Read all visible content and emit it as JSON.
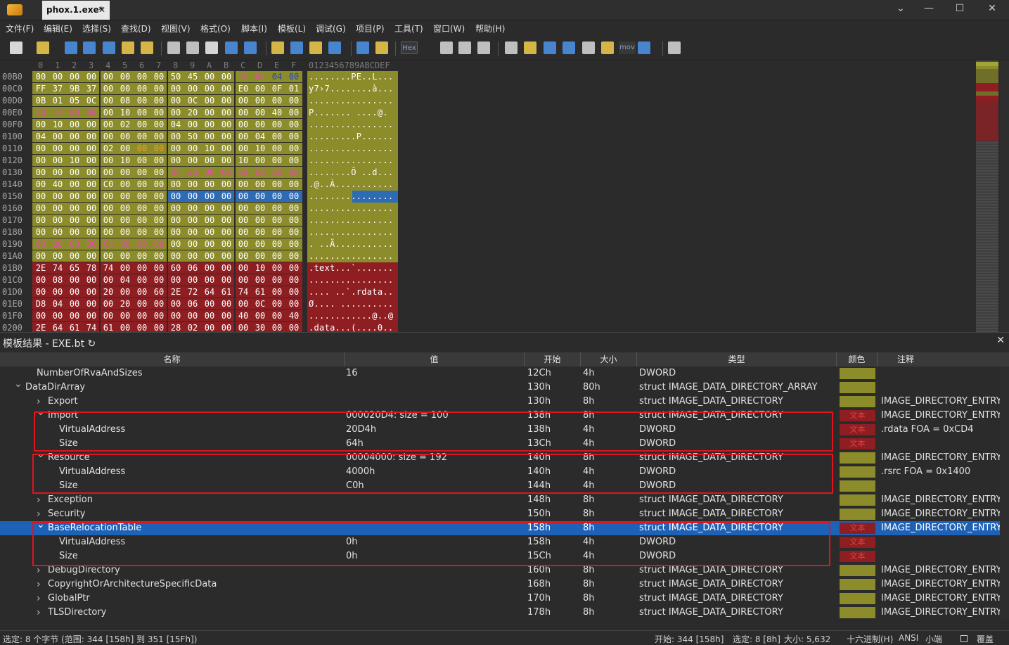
{
  "titlebar": {
    "tab_label": "phox.1.exe*",
    "controls": [
      "⌄",
      "—",
      "☐",
      "✕"
    ]
  },
  "menu": [
    "文件(F)",
    "编辑(E)",
    "选择(S)",
    "查找(D)",
    "视图(V)",
    "格式(O)",
    "脚本(I)",
    "模板(L)",
    "调试(G)",
    "项目(P)",
    "工具(T)",
    "窗口(W)",
    "帮助(H)"
  ],
  "toolbar": {
    "hex_label": "Hex",
    "mov_label": "mov"
  },
  "hex": {
    "header_cols": [
      "0",
      "1",
      "2",
      "3",
      "4",
      "5",
      "6",
      "7",
      "8",
      "9",
      "A",
      "B",
      "C",
      "D",
      "E",
      "F"
    ],
    "ascii_header": "0123456789ABCDEF",
    "rows": [
      {
        "addr": "00B0",
        "bytes": [
          "00",
          "00",
          "00",
          "00",
          "00",
          "00",
          "00",
          "00",
          "50",
          "45",
          "00",
          "00",
          "4C",
          "01",
          "04",
          "00"
        ],
        "ascii": "........PE..L..."
      },
      {
        "addr": "00C0",
        "bytes": [
          "FF",
          "37",
          "9B",
          "37",
          "00",
          "00",
          "00",
          "00",
          "00",
          "00",
          "00",
          "00",
          "E0",
          "00",
          "0F",
          "01"
        ],
        "ascii": "y7›7........à..."
      },
      {
        "addr": "00D0",
        "bytes": [
          "0B",
          "01",
          "05",
          "0C",
          "00",
          "08",
          "00",
          "00",
          "00",
          "0C",
          "00",
          "00",
          "00",
          "00",
          "00",
          "00"
        ],
        "ascii": "................"
      },
      {
        "addr": "00E0",
        "bytes": [
          "50",
          "14",
          "00",
          "00",
          "00",
          "10",
          "00",
          "00",
          "00",
          "20",
          "00",
          "00",
          "00",
          "00",
          "40",
          "00"
        ],
        "ascii": "P....... ....@."
      },
      {
        "addr": "00F0",
        "bytes": [
          "00",
          "10",
          "00",
          "00",
          "00",
          "02",
          "00",
          "00",
          "04",
          "00",
          "00",
          "00",
          "00",
          "00",
          "00",
          "00"
        ],
        "ascii": "................"
      },
      {
        "addr": "0100",
        "bytes": [
          "04",
          "00",
          "00",
          "00",
          "00",
          "00",
          "00",
          "00",
          "00",
          "50",
          "00",
          "00",
          "00",
          "04",
          "00",
          "00"
        ],
        "ascii": ".........P......"
      },
      {
        "addr": "0110",
        "bytes": [
          "00",
          "00",
          "00",
          "00",
          "02",
          "00",
          "00",
          "00",
          "00",
          "00",
          "10",
          "00",
          "00",
          "10",
          "00",
          "00"
        ],
        "ascii": "................"
      },
      {
        "addr": "0120",
        "bytes": [
          "00",
          "00",
          "10",
          "00",
          "00",
          "10",
          "00",
          "00",
          "00",
          "00",
          "00",
          "00",
          "10",
          "00",
          "00",
          "00"
        ],
        "ascii": "................"
      },
      {
        "addr": "0130",
        "bytes": [
          "00",
          "00",
          "00",
          "00",
          "00",
          "00",
          "00",
          "00",
          "D4",
          "20",
          "00",
          "00",
          "64",
          "00",
          "00",
          "00"
        ],
        "ascii": "........Ô ..d..."
      },
      {
        "addr": "0140",
        "bytes": [
          "00",
          "40",
          "00",
          "00",
          "C0",
          "00",
          "00",
          "00",
          "00",
          "00",
          "00",
          "00",
          "00",
          "00",
          "00",
          "00"
        ],
        "ascii": ".@..À..........."
      },
      {
        "addr": "0150",
        "bytes": [
          "00",
          "00",
          "00",
          "00",
          "00",
          "00",
          "00",
          "00",
          "00",
          "00",
          "00",
          "00",
          "00",
          "00",
          "00",
          "00"
        ],
        "ascii": "................"
      },
      {
        "addr": "0160",
        "bytes": [
          "00",
          "00",
          "00",
          "00",
          "00",
          "00",
          "00",
          "00",
          "00",
          "00",
          "00",
          "00",
          "00",
          "00",
          "00",
          "00"
        ],
        "ascii": "................"
      },
      {
        "addr": "0170",
        "bytes": [
          "00",
          "00",
          "00",
          "00",
          "00",
          "00",
          "00",
          "00",
          "00",
          "00",
          "00",
          "00",
          "00",
          "00",
          "00",
          "00"
        ],
        "ascii": "................"
      },
      {
        "addr": "0180",
        "bytes": [
          "00",
          "00",
          "00",
          "00",
          "00",
          "00",
          "00",
          "00",
          "00",
          "00",
          "00",
          "00",
          "00",
          "00",
          "00",
          "00"
        ],
        "ascii": "................"
      },
      {
        "addr": "0190",
        "bytes": [
          "00",
          "20",
          "00",
          "00",
          "C4",
          "00",
          "00",
          "00",
          "00",
          "00",
          "00",
          "00",
          "00",
          "00",
          "00",
          "00"
        ],
        "ascii": ". ..Ä..........."
      },
      {
        "addr": "01A0",
        "bytes": [
          "00",
          "00",
          "00",
          "00",
          "00",
          "00",
          "00",
          "00",
          "00",
          "00",
          "00",
          "00",
          "00",
          "00",
          "00",
          "00"
        ],
        "ascii": "................"
      },
      {
        "addr": "01B0",
        "bytes": [
          "2E",
          "74",
          "65",
          "78",
          "74",
          "00",
          "00",
          "00",
          "60",
          "06",
          "00",
          "00",
          "00",
          "10",
          "00",
          "00"
        ],
        "ascii": ".text...`......."
      },
      {
        "addr": "01C0",
        "bytes": [
          "00",
          "08",
          "00",
          "00",
          "00",
          "04",
          "00",
          "00",
          "00",
          "00",
          "00",
          "00",
          "00",
          "00",
          "00",
          "00"
        ],
        "ascii": "................"
      },
      {
        "addr": "01D0",
        "bytes": [
          "00",
          "00",
          "00",
          "00",
          "20",
          "00",
          "00",
          "60",
          "2E",
          "72",
          "64",
          "61",
          "74",
          "61",
          "00",
          "00"
        ],
        "ascii": ".... ..`.rdata.."
      },
      {
        "addr": "01E0",
        "bytes": [
          "D8",
          "04",
          "00",
          "00",
          "00",
          "20",
          "00",
          "00",
          "00",
          "06",
          "00",
          "00",
          "00",
          "0C",
          "00",
          "00"
        ],
        "ascii": "Ø.... .........."
      },
      {
        "addr": "01F0",
        "bytes": [
          "00",
          "00",
          "00",
          "00",
          "00",
          "00",
          "00",
          "00",
          "00",
          "00",
          "00",
          "00",
          "40",
          "00",
          "00",
          "40"
        ],
        "ascii": "............@..@"
      },
      {
        "addr": "0200",
        "bytes": [
          "2E",
          "64",
          "61",
          "74",
          "61",
          "00",
          "00",
          "00",
          "28",
          "02",
          "00",
          "00",
          "00",
          "30",
          "00",
          "00"
        ],
        "ascii": ".data...(....0.."
      }
    ]
  },
  "template": {
    "title": "模板结果 - EXE.bt ↻",
    "columns": {
      "name": "名称",
      "value": "值",
      "start": "开始",
      "size": "大小",
      "type": "类型",
      "color": "颜色",
      "comment": "注释"
    },
    "rows": [
      {
        "name": "NumberOfRvaAndSizes",
        "value": "16",
        "start": "12Ch",
        "size": "4h",
        "type": "DWORD",
        "color_text": "",
        "comment": ""
      },
      {
        "name": "DataDirArray",
        "value": "",
        "start": "130h",
        "size": "80h",
        "type": "struct IMAGE_DATA_DIRECTORY_ARRAY",
        "color_text": "",
        "comment": ""
      },
      {
        "name": "Export",
        "value": "",
        "start": "130h",
        "size": "8h",
        "type": "struct IMAGE_DATA_DIRECTORY",
        "color_text": "",
        "comment": "IMAGE_DIRECTORY_ENTRY"
      },
      {
        "name": "Import",
        "value": "000020D4: size = 100",
        "start": "138h",
        "size": "8h",
        "type": "struct IMAGE_DATA_DIRECTORY",
        "color_text": "文本",
        "comment": "IMAGE_DIRECTORY_ENTRY"
      },
      {
        "name": "VirtualAddress",
        "value": "20D4h",
        "start": "138h",
        "size": "4h",
        "type": "DWORD",
        "color_text": "文本",
        "comment": ".rdata FOA = 0xCD4"
      },
      {
        "name": "Size",
        "value": "64h",
        "start": "13Ch",
        "size": "4h",
        "type": "DWORD",
        "color_text": "文本",
        "comment": ""
      },
      {
        "name": "Resource",
        "value": "00004000: size = 192",
        "start": "140h",
        "size": "8h",
        "type": "struct IMAGE_DATA_DIRECTORY",
        "color_text": "",
        "comment": "IMAGE_DIRECTORY_ENTRY"
      },
      {
        "name": "VirtualAddress",
        "value": "4000h",
        "start": "140h",
        "size": "4h",
        "type": "DWORD",
        "color_text": "",
        "comment": ".rsrc FOA = 0x1400"
      },
      {
        "name": "Size",
        "value": "C0h",
        "start": "144h",
        "size": "4h",
        "type": "DWORD",
        "color_text": "",
        "comment": ""
      },
      {
        "name": "Exception",
        "value": "",
        "start": "148h",
        "size": "8h",
        "type": "struct IMAGE_DATA_DIRECTORY",
        "color_text": "",
        "comment": "IMAGE_DIRECTORY_ENTRY"
      },
      {
        "name": "Security",
        "value": "",
        "start": "150h",
        "size": "8h",
        "type": "struct IMAGE_DATA_DIRECTORY",
        "color_text": "",
        "comment": "IMAGE_DIRECTORY_ENTRY"
      },
      {
        "name": "BaseRelocationTable",
        "value": "",
        "start": "158h",
        "size": "8h",
        "type": "struct IMAGE_DATA_DIRECTORY",
        "color_text": "文本",
        "comment": "IMAGE_DIRECTORY_ENTRY"
      },
      {
        "name": "VirtualAddress",
        "value": "0h",
        "start": "158h",
        "size": "4h",
        "type": "DWORD",
        "color_text": "文本",
        "comment": ""
      },
      {
        "name": "Size",
        "value": "0h",
        "start": "15Ch",
        "size": "4h",
        "type": "DWORD",
        "color_text": "文本",
        "comment": ""
      },
      {
        "name": "DebugDirectory",
        "value": "",
        "start": "160h",
        "size": "8h",
        "type": "struct IMAGE_DATA_DIRECTORY",
        "color_text": "",
        "comment": "IMAGE_DIRECTORY_ENTRY"
      },
      {
        "name": "CopyrightOrArchitectureSpecificData",
        "value": "",
        "start": "168h",
        "size": "8h",
        "type": "struct IMAGE_DATA_DIRECTORY",
        "color_text": "",
        "comment": "IMAGE_DIRECTORY_ENTRY"
      },
      {
        "name": "GlobalPtr",
        "value": "",
        "start": "170h",
        "size": "8h",
        "type": "struct IMAGE_DATA_DIRECTORY",
        "color_text": "",
        "comment": "IMAGE_DIRECTORY_ENTRY"
      },
      {
        "name": "TLSDirectory",
        "value": "",
        "start": "178h",
        "size": "8h",
        "type": "struct IMAGE_DATA_DIRECTORY",
        "color_text": "",
        "comment": "IMAGE_DIRECTORY_ENTRY"
      }
    ]
  },
  "status": {
    "selection": "选定: 8 个字节 (范围: 344 [158h] 到 351 [15Fh])",
    "start": "开始: 344 [158h]",
    "sel": "选定: 8 [8h]",
    "size": "大小: 5,632",
    "mode": "十六进制(H)",
    "encoding": "ANSI",
    "endian": "小端",
    "overwrite": "覆盖"
  },
  "colors": {
    "olive": "#8c8c2a",
    "red": "#8f1e22",
    "selection": "#1e62b8",
    "highlight_box": "#e0141e",
    "magenta_text": "#e84ab0"
  }
}
